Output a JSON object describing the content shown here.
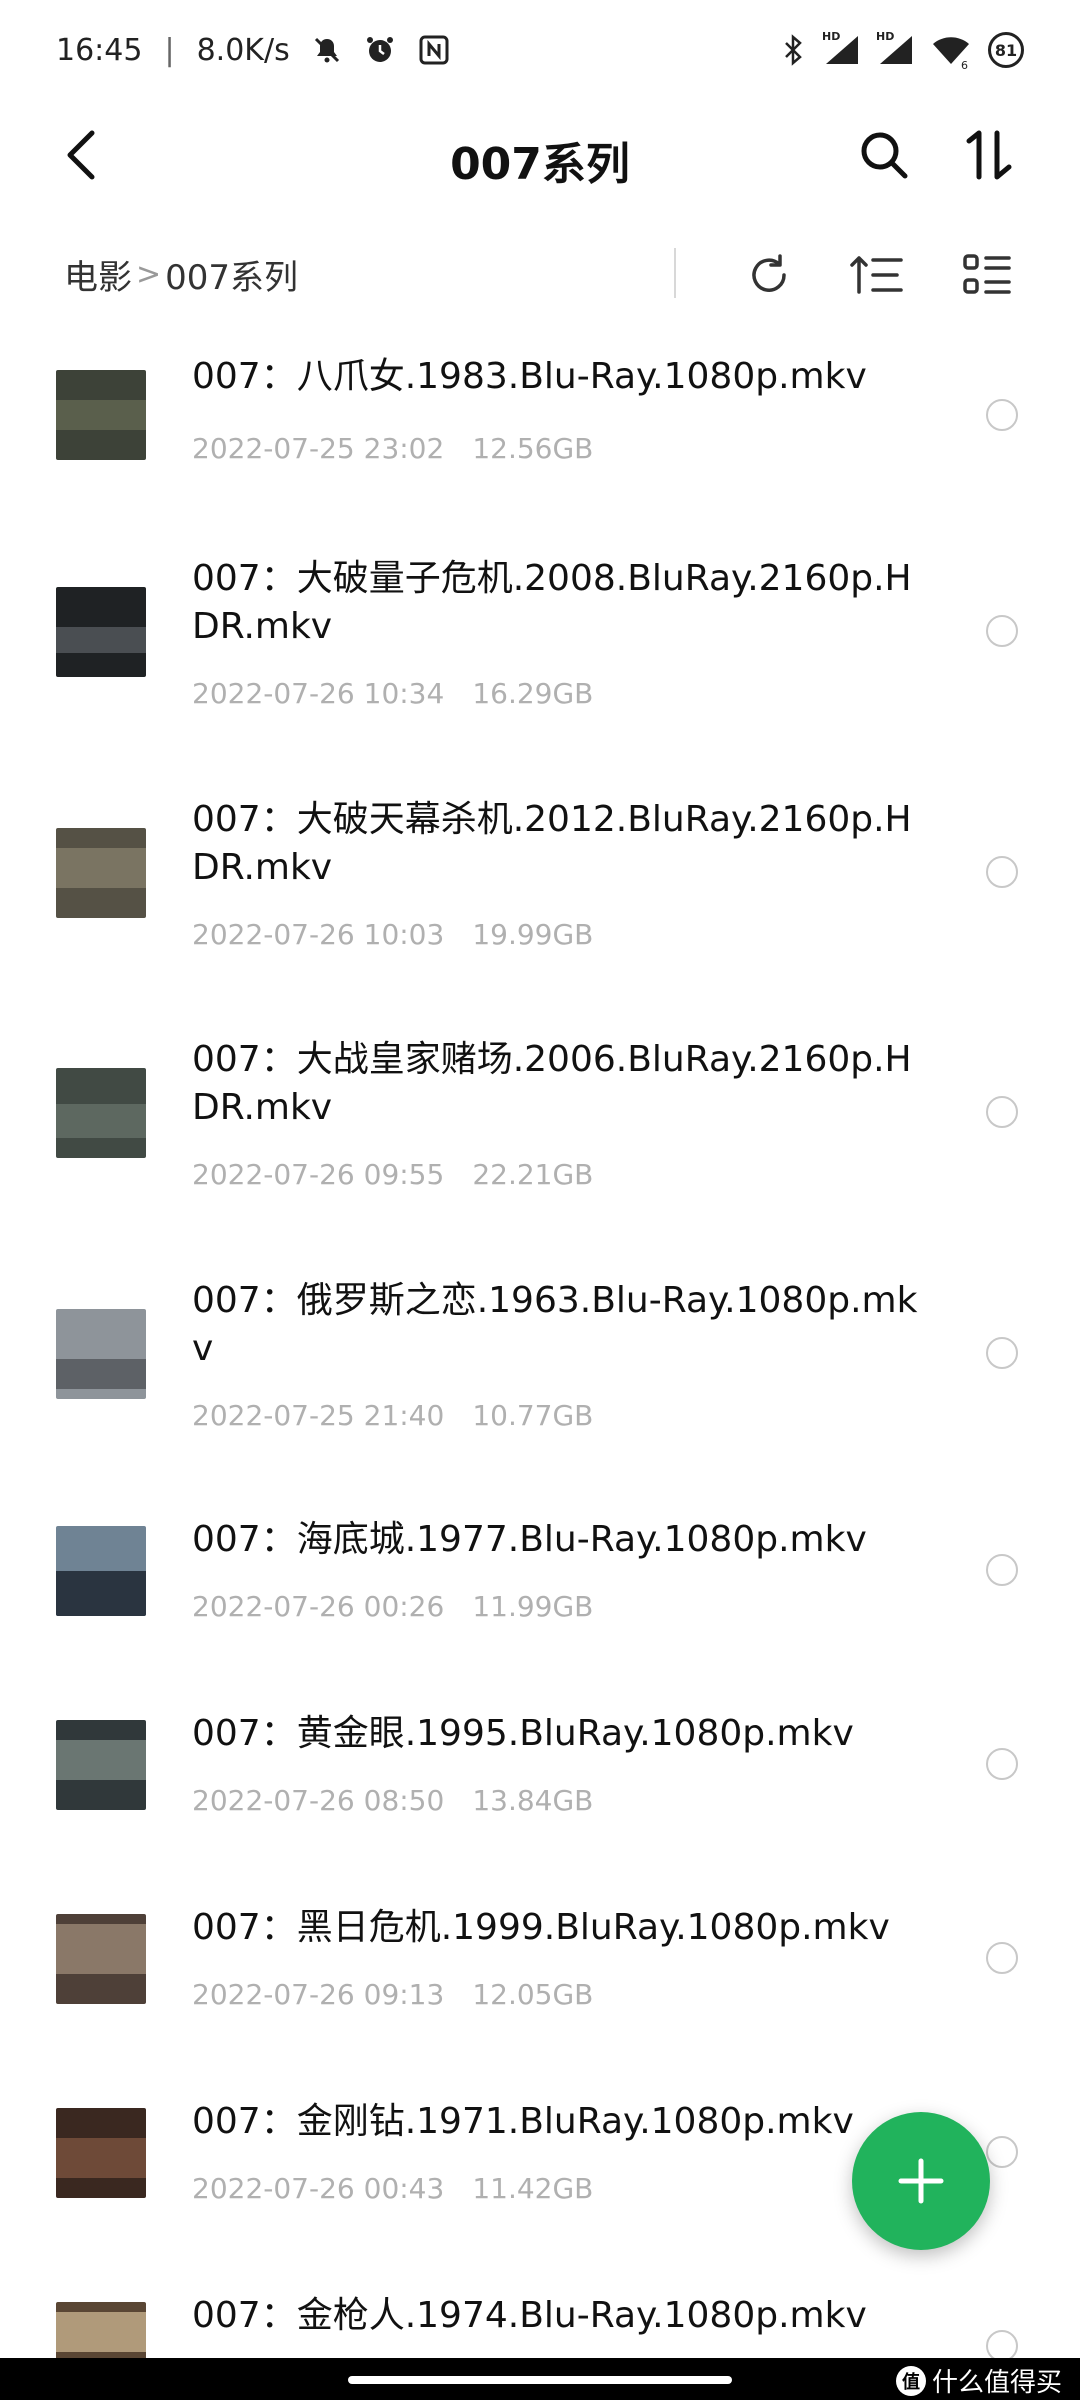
{
  "status_bar": {
    "time": "16:45",
    "separator": "|",
    "net_speed": "8.0K/s",
    "signal_1_label": "HD",
    "signal_2_label": "HD",
    "wifi_label": "6",
    "battery": "81",
    "icons": [
      "mute-icon",
      "alarm-icon",
      "nfc-icon",
      "bluetooth-icon",
      "signal-icon",
      "wifi-icon",
      "battery-icon"
    ]
  },
  "header": {
    "title": "007系列",
    "icons": [
      "back-icon",
      "search-icon",
      "sort-icon"
    ]
  },
  "breadcrumb": {
    "root": "电影",
    "separator": ">",
    "current": "007系列"
  },
  "toolbar": {
    "icons": [
      "refresh-icon",
      "sort-order-icon",
      "view-list-icon"
    ]
  },
  "files": [
    {
      "name": "007：八爪女.1983.Blu-Ray.1080p.mkv",
      "date": "2022-07-25 23:02",
      "size": "12.56GB"
    },
    {
      "name": "007：大破量子危机.2008.BluRay.2160p.HDR.mkv",
      "date": "2022-07-26 10:34",
      "size": "16.29GB"
    },
    {
      "name": "007：大破天幕杀机.2012.BluRay.2160p.HDR.mkv",
      "date": "2022-07-26 10:03",
      "size": "19.99GB"
    },
    {
      "name": "007：大战皇家赌场.2006.BluRay.2160p.HDR.mkv",
      "date": "2022-07-26 09:55",
      "size": "22.21GB"
    },
    {
      "name": "007：俄罗斯之恋.1963.Blu-Ray.1080p.mkv",
      "date": "2022-07-25 21:40",
      "size": "10.77GB"
    },
    {
      "name": "007：海底城.1977.Blu-Ray.1080p.mkv",
      "date": "2022-07-26 00:26",
      "size": "11.99GB"
    },
    {
      "name": "007：黄金眼.1995.BluRay.1080p.mkv",
      "date": "2022-07-26 08:50",
      "size": "13.84GB"
    },
    {
      "name": "007：黑日危机.1999.BluRay.1080p.mkv",
      "date": "2022-07-26 09:13",
      "size": "12.05GB"
    },
    {
      "name": "007：金刚钻.1971.BluRay.1080p.mkv",
      "date": "2022-07-26 00:43",
      "size": "11.42GB"
    },
    {
      "name": "007：金枪人.1974.Blu-Ray.1080p.mkv",
      "date": "",
      "size": ""
    }
  ],
  "fab": {
    "icon": "plus-icon"
  },
  "watermark": {
    "logo": "值",
    "text": "什么值得买"
  },
  "colors": {
    "accent": "#21b35c",
    "meta_text": "#b0b0b0",
    "circle": "#c8c8c8"
  }
}
